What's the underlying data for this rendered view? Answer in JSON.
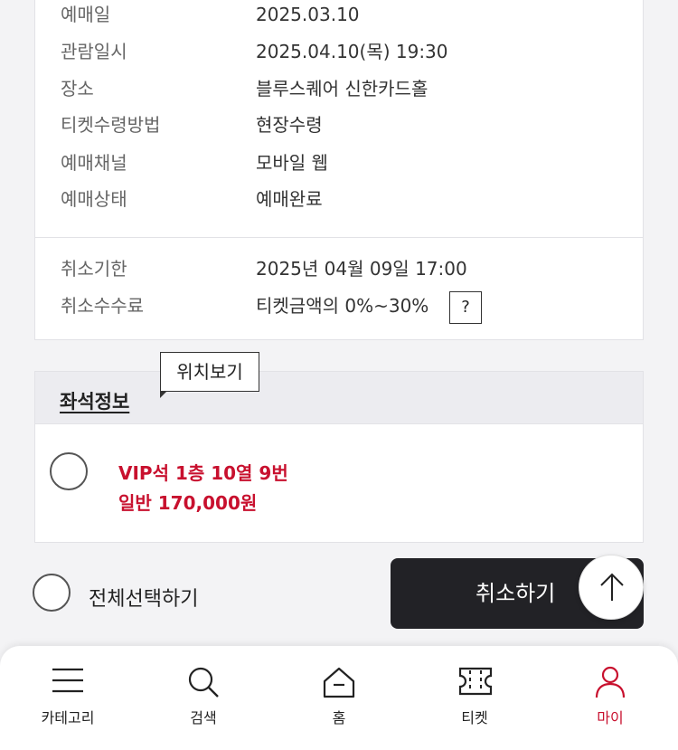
{
  "booking_info": {
    "rows": [
      {
        "label": "예매일",
        "value": "2025.03.10"
      },
      {
        "label": "관람일시",
        "value": "2025.04.10(목) 19:30"
      },
      {
        "label": "장소",
        "value": "블루스퀘어 신한카드홀"
      },
      {
        "label": "티켓수령방법",
        "value": "현장수령"
      },
      {
        "label": "예매채널",
        "value": "모바일 웹"
      },
      {
        "label": "예매상태",
        "value": "예매완료"
      }
    ],
    "cancel_rows": [
      {
        "label": "취소기한",
        "value": "2025년 04월 09일 17:00"
      },
      {
        "label": "취소수수료",
        "value": "티켓금액의 0%~30%"
      }
    ],
    "help_label": "?"
  },
  "seat_info": {
    "title": "좌석정보",
    "tooltip": "위치보기",
    "seat": {
      "line1": "VIP석 1층 10열 9번",
      "line2": "일반 170,000원"
    }
  },
  "actions": {
    "select_all": "전체선택하기",
    "cancel": "취소하기"
  },
  "bottom_nav": {
    "items": [
      {
        "label": "카테고리",
        "icon": "menu-icon"
      },
      {
        "label": "검색",
        "icon": "search-icon"
      },
      {
        "label": "홈",
        "icon": "home-icon"
      },
      {
        "label": "티켓",
        "icon": "ticket-icon"
      },
      {
        "label": "마이",
        "icon": "user-icon",
        "active": true
      }
    ]
  },
  "colors": {
    "accent": "#c8102e",
    "dark_button": "#222226"
  }
}
